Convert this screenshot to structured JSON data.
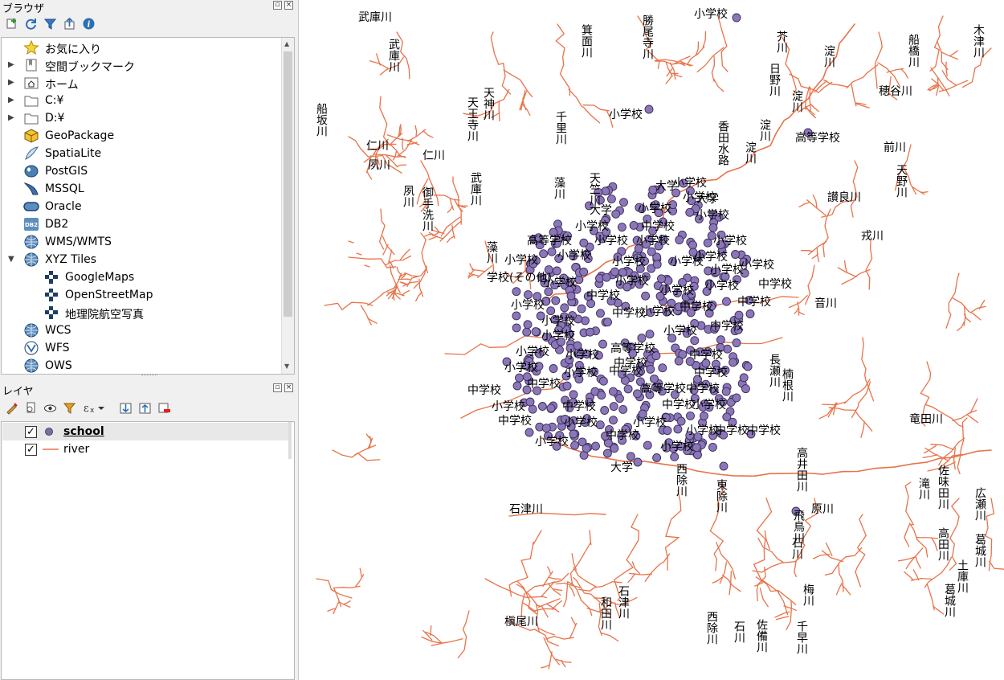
{
  "browser_panel": {
    "title": "ブラウザ",
    "items": [
      {
        "label": "お気に入り",
        "icon": "star-icon"
      },
      {
        "label": "空間ブックマーク",
        "icon": "bookmark-icon"
      },
      {
        "label": "ホーム",
        "icon": "home-folder-icon"
      },
      {
        "label": "C:¥",
        "icon": "folder-icon"
      },
      {
        "label": "D:¥",
        "icon": "folder-icon"
      },
      {
        "label": "GeoPackage",
        "icon": "geopackage-icon"
      },
      {
        "label": "SpatiaLite",
        "icon": "spatialite-icon"
      },
      {
        "label": "PostGIS",
        "icon": "postgis-icon"
      },
      {
        "label": "MSSQL",
        "icon": "mssql-icon"
      },
      {
        "label": "Oracle",
        "icon": "oracle-icon"
      },
      {
        "label": "DB2",
        "icon": "db2-icon"
      },
      {
        "label": "WMS/WMTS",
        "icon": "globe-icon"
      },
      {
        "label": "XYZ Tiles",
        "icon": "globe-icon"
      },
      {
        "label": "GoogleMaps",
        "icon": "xyz-tile-icon"
      },
      {
        "label": "OpenStreetMap",
        "icon": "xyz-tile-icon"
      },
      {
        "label": "地理院航空写真",
        "icon": "xyz-tile-icon"
      },
      {
        "label": "WCS",
        "icon": "globe-icon"
      },
      {
        "label": "WFS",
        "icon": "wfs-icon"
      },
      {
        "label": "OWS",
        "icon": "globe-icon"
      }
    ],
    "db2_badge": "DB2"
  },
  "layers_panel": {
    "title": "レイヤ",
    "layers": [
      {
        "name": "school",
        "checked": true,
        "symbol": "point",
        "color": "#7f6aaa"
      },
      {
        "name": "river",
        "checked": true,
        "symbol": "line",
        "color": "#e8734a"
      }
    ]
  },
  "map": {
    "river_color": "#e8734a",
    "school_color": "#8a76b8",
    "labels": {
      "takarazuka1": "武庫川",
      "takarazuka2": "武庫川",
      "shogakko_top": "小学校",
      "katsuoji": "勝尾寺川",
      "minoo": "箕面川",
      "akutagawa": "芥川",
      "yodo_top": "淀川",
      "kizu": "木津川",
      "funahashi": "船橋川",
      "hotani": "穂谷川",
      "hino": "日野川",
      "yodo_mid": "淀川",
      "funasaka": "船坂川",
      "tenjin": "天神川",
      "tennoji": "天王寺川",
      "shogakko_a": "小学校",
      "kagawa_road": "香田水路",
      "yodo3": "淀川",
      "koko_top": "高等学校",
      "mae": "前川",
      "nigawa1": "仁川",
      "shukugawa1": "夙川",
      "nigawa2": "仁川",
      "shukugawa2": "夙川",
      "mitarai": "御手洗川",
      "muko3": "武庫川",
      "senri": "千里川",
      "aigawa": "藻川",
      "tenchiku": "天竺川",
      "amano": "天野川",
      "sanuki": "讃良川",
      "ikoma": "戎川",
      "daigaku_top": "大学",
      "aogawa": "藻川",
      "gakko_sonota": "学校(その他)",
      "otogawa": "音川",
      "nagase": "長瀬川",
      "kusunone": "楠根川",
      "tatsuta": "竜田川",
      "takaida": "高井田川",
      "sahota": "佐味田川",
      "takigawa": "滝川",
      "hirose": "広瀬川",
      "katsuragi": "葛城川",
      "harakawa": "原川",
      "asuka": "飛鳥川",
      "ishikawa1": "石川",
      "takadagawa": "高田川",
      "dodagawa": "土庫川",
      "katsuragi2": "葛城川",
      "ishizu1": "石津川",
      "nishijo": "西除川",
      "higashijo": "東除川",
      "ishizu2": "石津川",
      "wada": "和田川",
      "makio": "槇尾川",
      "nishijo2": "西除川",
      "ishikawa2": "石川",
      "sayama": "佐備川",
      "umegawa": "梅川",
      "chihaya": "千早川",
      "daigaku_bottom": "大学"
    },
    "school_labels": [
      "小学校",
      "小学校",
      "大学",
      "小学校",
      "大学",
      "小学校",
      "小学校",
      "中学校",
      "小学校",
      "小学校",
      "高等学校",
      "小学校",
      "小学校",
      "小学校",
      "小学校",
      "小学校",
      "小学校",
      "小学校",
      "小学校",
      "中学校",
      "小学校",
      "小学校",
      "小学校",
      "小学校",
      "中学校",
      "小学校",
      "中学校",
      "中学校",
      "小学校",
      "小学校",
      "中学校",
      "高等学校",
      "小学校",
      "小学校",
      "中学校",
      "小学校",
      "小学校",
      "中学校",
      "中学校",
      "小学校",
      "小学校",
      "中学校",
      "中学校",
      "中学校",
      "中学校",
      "高等学校",
      "中学校",
      "小学校",
      "中学校",
      "小学校",
      "中学校",
      "中学校",
      "小学校",
      "小学校",
      "小学校",
      "中学校",
      "中学校",
      "中学校",
      "小学校",
      "小学校"
    ]
  }
}
